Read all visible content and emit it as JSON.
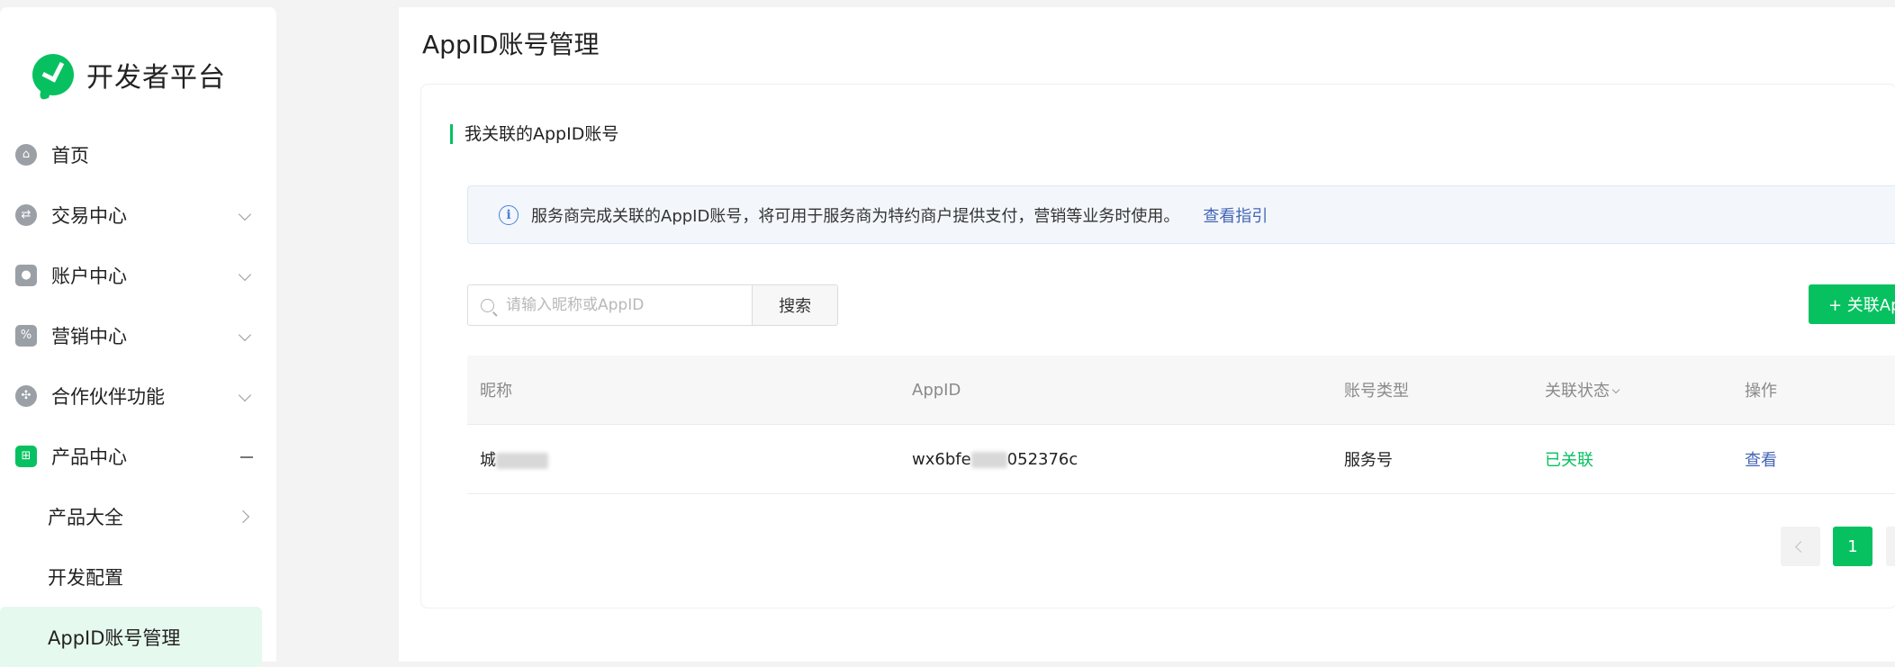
{
  "app": {
    "logo_text": "开发者平台",
    "accent": "#07c160"
  },
  "sidebar": {
    "items": [
      {
        "label": "首页",
        "icon": "home-icon"
      },
      {
        "label": "交易中心",
        "icon": "exchange-icon"
      },
      {
        "label": "账户中心",
        "icon": "account-icon"
      },
      {
        "label": "营销中心",
        "icon": "marketing-icon"
      },
      {
        "label": "合作伙伴功能",
        "icon": "partner-icon"
      },
      {
        "label": "产品中心",
        "icon": "product-grid-icon"
      }
    ],
    "sub_items": [
      {
        "label": "产品大全"
      },
      {
        "label": "开发配置"
      },
      {
        "label": "AppID账号管理"
      }
    ]
  },
  "main": {
    "page_title": "AppID账号管理",
    "section_title": "我关联的AppID账号",
    "notice": {
      "text": "服务商完成关联的AppID账号，将可用于服务商为特约商户提供支付，营销等业务时使用。",
      "link": "查看指引"
    },
    "search": {
      "placeholder": "请输入昵称或AppID",
      "button": "搜索"
    },
    "add_button": "+ 关联AppID",
    "table": {
      "headers": [
        "昵称",
        "AppID",
        "账号类型",
        "关联状态",
        "操作"
      ],
      "rows": [
        {
          "nickname": "城",
          "appid_prefix": "wx6bfe",
          "appid_suffix": "052376c",
          "type": "服务号",
          "status": "已关联",
          "action": "查看"
        }
      ]
    },
    "pagination": {
      "current_page": "1"
    }
  }
}
